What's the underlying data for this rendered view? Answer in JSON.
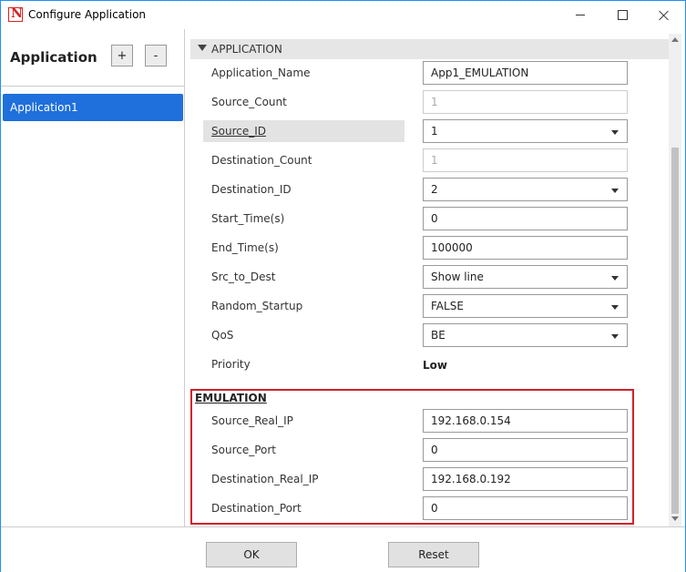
{
  "window": {
    "title": "Configure Application"
  },
  "sidebar": {
    "heading": "Application",
    "add_label": "+",
    "remove_label": "-",
    "items": [
      "Application1"
    ],
    "selected_color": "#1f6fdc"
  },
  "section": {
    "title": "APPLICATION",
    "rows": [
      {
        "label": "Application_Name",
        "value": "App1_EMULATION",
        "kind": "text"
      },
      {
        "label": "Source_Count",
        "value": "1",
        "kind": "disabled"
      },
      {
        "label": "Source_ID",
        "value": "1",
        "kind": "dropdown",
        "highlighted": true
      },
      {
        "label": "Destination_Count",
        "value": "1",
        "kind": "disabled"
      },
      {
        "label": "Destination_ID",
        "value": "2",
        "kind": "dropdown"
      },
      {
        "label": "Start_Time(s)",
        "value": "0",
        "kind": "text"
      },
      {
        "label": "End_Time(s)",
        "value": "100000",
        "kind": "text"
      },
      {
        "label": "Src_to_Dest",
        "value": "Show line",
        "kind": "dropdown"
      },
      {
        "label": "Random_Startup",
        "value": "FALSE",
        "kind": "dropdown"
      },
      {
        "label": "QoS",
        "value": "BE",
        "kind": "dropdown"
      },
      {
        "label": "Priority",
        "value": "Low",
        "kind": "static"
      }
    ]
  },
  "emulation": {
    "title": "EMULATION",
    "border_color": "#d0202a",
    "rows": [
      {
        "label": "Source_Real_IP",
        "value": "192.168.0.154"
      },
      {
        "label": "Source_Port",
        "value": "0"
      },
      {
        "label": "Destination_Real_IP",
        "value": "192.168.0.192"
      },
      {
        "label": "Destination_Port",
        "value": "0"
      }
    ]
  },
  "footer": {
    "ok_label": "OK",
    "reset_label": "Reset"
  }
}
